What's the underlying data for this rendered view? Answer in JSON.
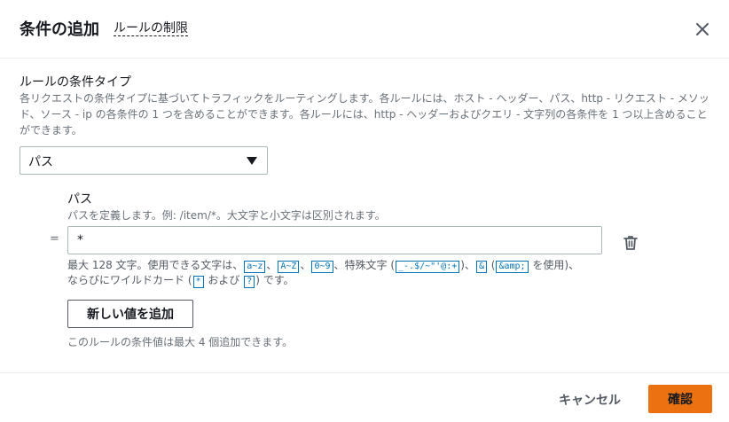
{
  "modal": {
    "title": "条件の追加",
    "limits_link": "ルールの制限"
  },
  "condition_type": {
    "label": "ルールの条件タイプ",
    "description": "各リクエストの条件タイプに基づいてトラフィックをルーティングします。各ルールには、ホスト - ヘッダー、パス、http - リクエスト - メソッド、ソース - ip の各条件の 1 つを含めることができます。各ルールには、http - ヘッダーおよびクエリ - 文字列の各条件を 1 つ以上含めることができます。",
    "selected": "パス"
  },
  "path": {
    "label": "パス",
    "description": "パスを定義します。例: /item/*。大文字と小文字は区別されます。",
    "operator": "=",
    "value": "*",
    "constraint": {
      "part1": "最大 128 文字。使用できる文字は、",
      "tok_lower": "a~z",
      "sep1": "、",
      "tok_upper": "A~Z",
      "sep2": "、",
      "tok_digits": "0~9",
      "part2": "、特殊文字 (",
      "tok_special": "_-.$/~\"'@:+",
      "part3": ")、",
      "tok_amp": "&",
      "part4": " (",
      "tok_amp_entity": "&amp;",
      "part5": " を使用)、",
      "part6": "ならびにワイルドカード (",
      "tok_star": "*",
      "part7": " および ",
      "tok_q": "?",
      "part8": ") です。"
    },
    "add_value_button": "新しい値を追加",
    "limit_note": "このルールの条件値は最大 4 個追加できます。"
  },
  "footer": {
    "cancel": "キャンセル",
    "confirm": "確認"
  },
  "colors": {
    "accent": "#ec7211",
    "link": "#0073bb",
    "border": "#aab7b8"
  },
  "icons": [
    "close-icon",
    "trash-icon",
    "caret-down-icon"
  ]
}
